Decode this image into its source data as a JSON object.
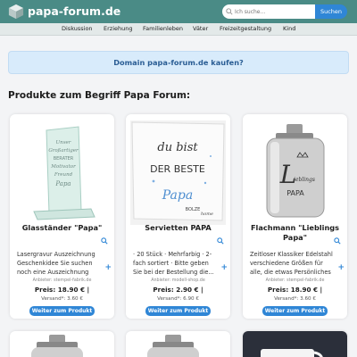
{
  "header": {
    "site_name": "papa-forum.de",
    "search_placeholder": "Ich suche...",
    "search_button": "Suchen",
    "logo_icon": "cube-icon",
    "brand_color": "#4a8b86"
  },
  "nav": {
    "items": [
      "Diskussion",
      "Erziehung",
      "Familienleben",
      "Väter",
      "Freizeitgestaltung",
      "Kind"
    ]
  },
  "banner": {
    "text": "Domain papa-forum.de kaufen?"
  },
  "section": {
    "title": "Produkte zum Begriff Papa Forum:"
  },
  "products": [
    {
      "title": "Glasständer \"Papa\"",
      "description": "Lasergravur Auszeichnung Geschenkidee Sie suchen noch eine Auszeichnung für...",
      "vendor": "Anbieter: stempel-fabrik.de",
      "price": "Preis: 18.90 € |",
      "shipping": "Versand*: 3.60 €",
      "button": "Weiter zum Produkt",
      "image_text": [
        "Unser",
        "Großartiger",
        "BERATER",
        "Motivator",
        "Freund",
        "Papa"
      ]
    },
    {
      "title": "Servietten PAPA",
      "description": "· 20 Stück · Mehrfarbig · 2-fach sortiert · Bitte geben Sie bei der Bestellung die...",
      "vendor": "Anbieter: modell-shop.de",
      "price": "Preis: 2.90 € |",
      "shipping": "Versand*: 6.90 €",
      "button": "Weiter zum Produkt",
      "image_text": [
        "du bist",
        "DER BESTE",
        "Papa",
        "BOLZE",
        "home"
      ]
    },
    {
      "title": "Flachmann \"Lieblings Papa\"",
      "description": "Zeitloser Klassiker Edelstahl verschiedene Größen für alle, die etwas Persönliches such...",
      "vendor": "Anbieter: stempel-fabrik.de",
      "price": "Preis: 18.90 € |",
      "shipping": "Versand*: 3.60 €",
      "button": "Weiter zum Produkt",
      "image_text": [
        "L",
        "ieblings",
        "PAPA"
      ]
    }
  ]
}
